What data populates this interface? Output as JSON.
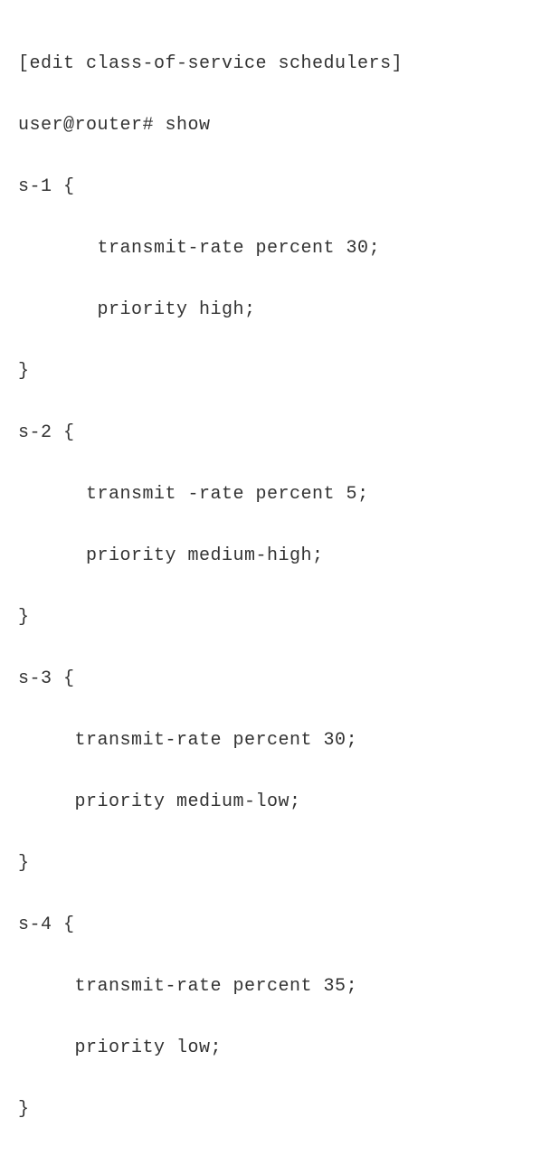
{
  "context": "[edit class-of-service schedulers]",
  "prompt": "user@router# show",
  "schedulers": [
    {
      "name": "s-1",
      "open": "s-1 {",
      "indent": "       ",
      "transmit": "transmit-rate percent 30;",
      "priority": "priority high;",
      "close": "}"
    },
    {
      "name": "s-2",
      "open": "s-2 {",
      "indent": "      ",
      "transmit": "transmit -rate percent 5;",
      "priority": "priority medium-high;",
      "close": "}"
    },
    {
      "name": "s-3",
      "open": "s-3 {",
      "indent": "     ",
      "transmit": "transmit-rate percent 30;",
      "priority": "priority medium-low;",
      "close": "}"
    },
    {
      "name": "s-4",
      "open": "s-4 {",
      "indent": "     ",
      "transmit": "transmit-rate percent 35;",
      "priority": "priority low;",
      "close": "}"
    }
  ]
}
